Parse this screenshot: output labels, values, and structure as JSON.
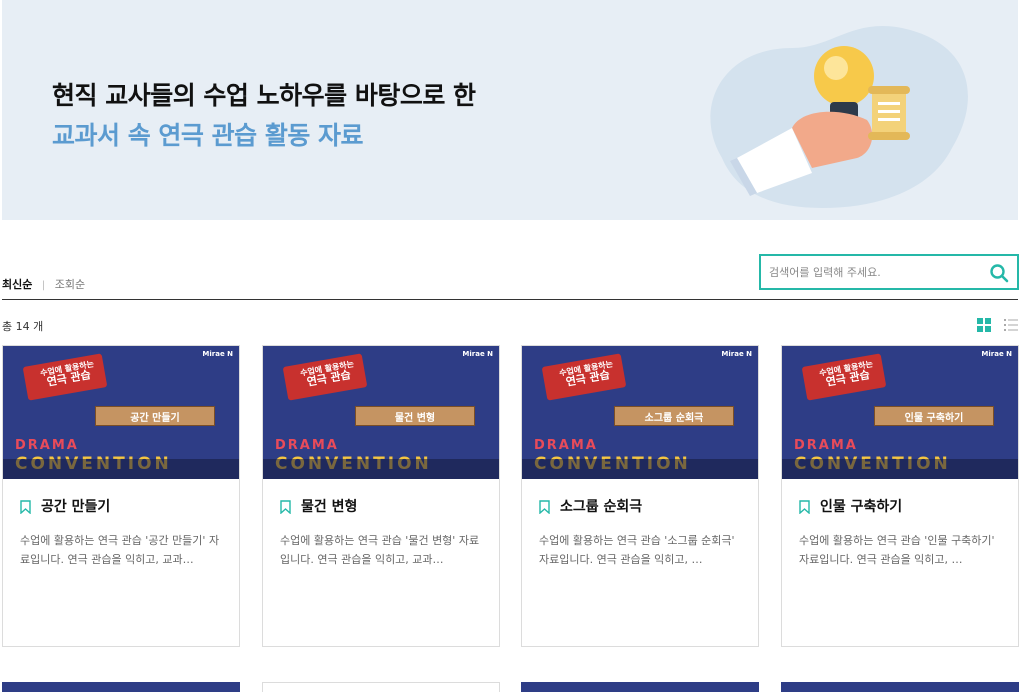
{
  "banner": {
    "title": "현직 교사들의 수업 노하우를 바탕으로 한",
    "subtitle": "교과서 속 연극 관습 활동 자료"
  },
  "sort": {
    "active": "최신순",
    "separator": "|",
    "other": "조회순"
  },
  "search": {
    "placeholder": "검색어를 입력해 주세요."
  },
  "total": "총 14 개",
  "cards": [
    {
      "title": "공간 만들기",
      "desc": "수업에 활용하는 연극 관습 '공간 만들기' 자료입니다. 연극 관습을 익히고, 교과…",
      "thumb_label": "공간 만들기"
    },
    {
      "title": "물건 변형",
      "desc": "수업에 활용하는 연극 관습 '물건 변형' 자료입니다. 연극 관습을 익히고, 교과…",
      "thumb_label": "물건 변형"
    },
    {
      "title": "소그룹 순회극",
      "desc": "수업에 활용하는 연극 관습 '소그룹 순회극' 자료입니다. 연극 관습을 익히고, …",
      "thumb_label": "소그룹 순회극"
    },
    {
      "title": "인물 구축하기",
      "desc": "수업에 활용하는 연극 관습 '인물 구축하기' 자료입니다. 연극 관습을 익히고, …",
      "thumb_label": "인물 구축하기"
    }
  ],
  "thumb_common": {
    "badge_line1": "수업에 활용하는",
    "badge_line2": "연극 관습",
    "brand": "Mirae N",
    "drama": "DRAMA",
    "convention": "CONVENTION"
  },
  "colors": {
    "accent": "#25b8a8",
    "banner_bg": "#e7eef5",
    "subtitle": "#5b9bd0",
    "thumb_bg": "#2e3d86"
  }
}
